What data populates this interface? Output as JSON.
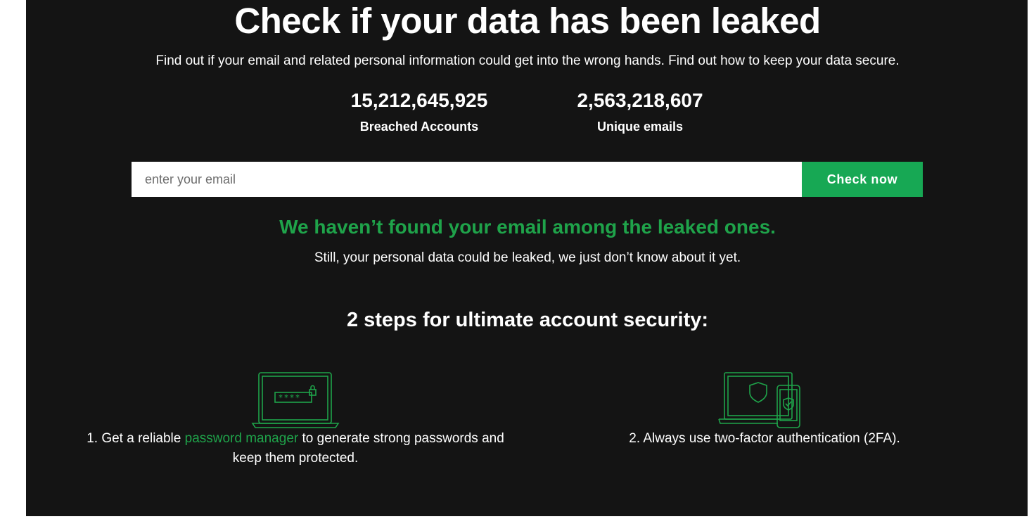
{
  "hero": {
    "title": "Check if your data has been leaked",
    "subtitle": "Find out if your email and related personal information could get into the wrong hands. Find out how to keep your data secure."
  },
  "stats": [
    {
      "number": "15,212,645,925",
      "label": "Breached Accounts"
    },
    {
      "number": "2,563,218,607",
      "label": "Unique emails"
    }
  ],
  "search": {
    "placeholder": "enter your email",
    "value": "",
    "button_label": "Check now"
  },
  "result": {
    "title": "We haven’t found your email among the leaked ones.",
    "subtitle": "Still, your personal data could be leaked, we just don’t know about it yet."
  },
  "steps": {
    "title": "2 steps for ultimate account security:",
    "step1": {
      "prefix": "1. Get a reliable ",
      "link": "password manager",
      "suffix": " to generate strong passwords and keep them protected.",
      "icon": "laptop-password-icon"
    },
    "step2": {
      "text": "2. Always use two-factor authentication (2FA).",
      "icon": "devices-shield-icon"
    }
  },
  "colors": {
    "background": "#141414",
    "accent": "#17a854",
    "accent_text": "#1fa34a"
  }
}
